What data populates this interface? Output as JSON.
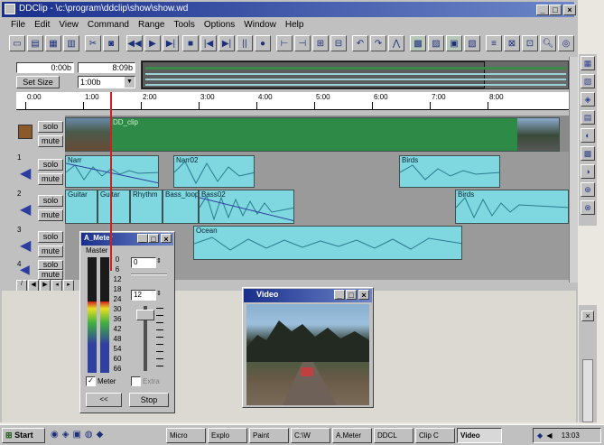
{
  "window": {
    "title": "DDClip - \\c:\\program\\ddclip\\show\\show.wd"
  },
  "menu": [
    "File",
    "Edit",
    "View",
    "Command",
    "Range",
    "Tools",
    "Options",
    "Window",
    "Help"
  ],
  "range_panel": {
    "start": "0:00b",
    "end": "8:09b",
    "set_size_label": "Set Size",
    "size_value": "1:00b"
  },
  "ruler": [
    "0:00",
    "1:00",
    "2:00",
    "3:00",
    "4:00",
    "5:00",
    "6:00",
    "7:00",
    "8:00"
  ],
  "track_buttons": {
    "solo": "solo",
    "mute": "mute"
  },
  "track_numbers": [
    "1",
    "2",
    "3",
    "4"
  ],
  "clips": {
    "video": [
      "DD_clip"
    ],
    "track1": [
      "Narr",
      "Narr02",
      "Birds"
    ],
    "track2": [
      "Guitar",
      "Guitar",
      "Rhythm",
      "Bass_loop",
      "Bass02",
      "Birds"
    ],
    "track3": [
      "Ocean"
    ]
  },
  "meter_window": {
    "title": "A_Meter",
    "master_label": "Master",
    "scale": [
      "0",
      "6",
      "12",
      "18",
      "24",
      "30",
      "36",
      "42",
      "48",
      "54",
      "60",
      "66"
    ],
    "spin1_value": "0",
    "spin2_value": "12",
    "meter_checkbox": "Meter",
    "extra_checkbox": "Extra",
    "rewind_label": "<<",
    "stop_label": "Stop",
    "meter_level": 0.62
  },
  "video_window": {
    "title": "Video"
  },
  "taskbar": {
    "start": "Start",
    "tasks": [
      "Micro",
      "Explo",
      "Paint",
      "C:\\W",
      "A.Meter",
      "DDCL",
      "Clip C",
      "Video"
    ],
    "clock": "13:03"
  },
  "colors": {
    "wave": "#7fd8e0",
    "video_clip": "#2e8b47",
    "track_bg": "#9a9a9a",
    "titlebar": "#1a2f8c"
  }
}
